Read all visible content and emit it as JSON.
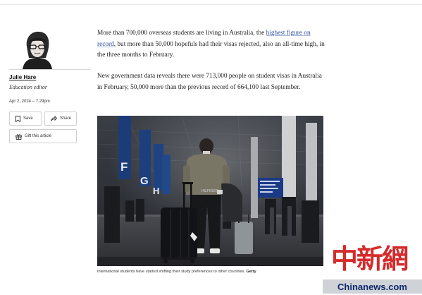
{
  "author": {
    "name": "Julie Hare",
    "role": "Education editor",
    "date": "Apr 2, 2024 – 7.29pm"
  },
  "actions": {
    "save_label": "Save",
    "share_label": "Share",
    "gift_label": "Gift this article"
  },
  "article": {
    "p1_before": "More than 700,000 overseas students are living in Australia, the ",
    "p1_link": "highest figure on record",
    "p1_after": ", but more than 50,000 hopefuls had their visas rejected, also an all-time high, in the three months to February.",
    "p2": "New government data reveals there were 713,000 people on student visas in Australia in February, 50,000 more than the previous record of 664,100 last September.",
    "image_signs": [
      "F",
      "G",
      "H"
    ],
    "image_bag_brand": "HILFIGER",
    "caption": "International students have started shifting their study preferences to other countries.",
    "caption_credit": "Getty"
  },
  "watermark": {
    "chinese": "中新網",
    "english": "Chinanews.com"
  },
  "colors": {
    "link": "#2e4e9e",
    "watermark_red": "#d11a1a",
    "watermark_blue": "#0e2a6b"
  }
}
